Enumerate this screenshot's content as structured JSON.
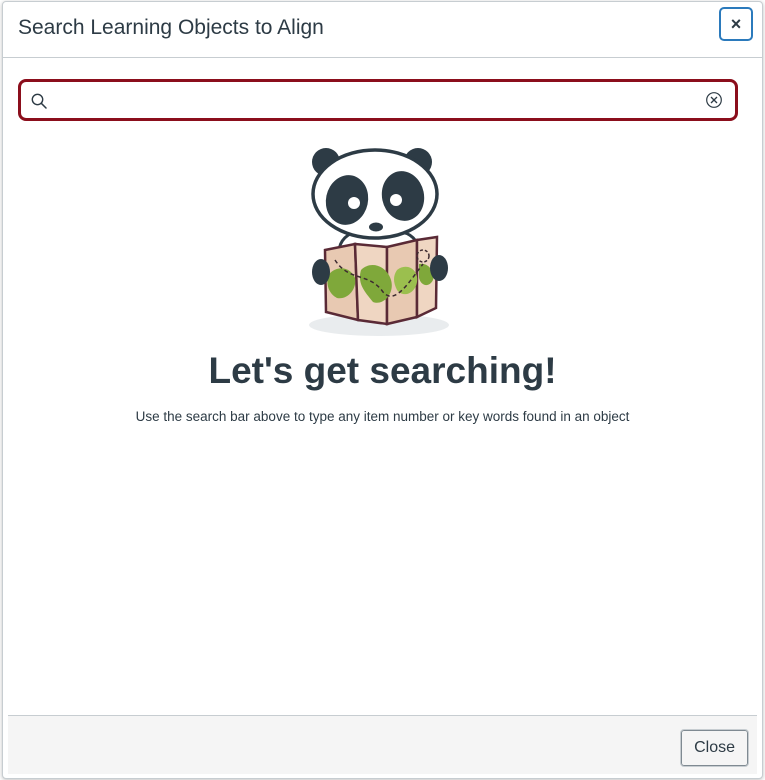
{
  "modal": {
    "title": "Search Learning Objects to Align",
    "close_icon_label": "×"
  },
  "search": {
    "value": "",
    "placeholder": ""
  },
  "empty_state": {
    "heading": "Let's get searching!",
    "description": "Use the search bar above to type any item number or key words found in an object"
  },
  "footer": {
    "close_label": "Close"
  },
  "icons": {
    "search": "search-icon",
    "clear": "clear-circle-x-icon",
    "close": "close-icon",
    "illustration": "panda-with-map-illustration"
  },
  "colors": {
    "text": "#2d3b45",
    "focus_border": "#8b0e1c",
    "close_focus": "#2b7abc",
    "border": "#c7cdd1",
    "footer_bg": "#f5f5f5"
  }
}
